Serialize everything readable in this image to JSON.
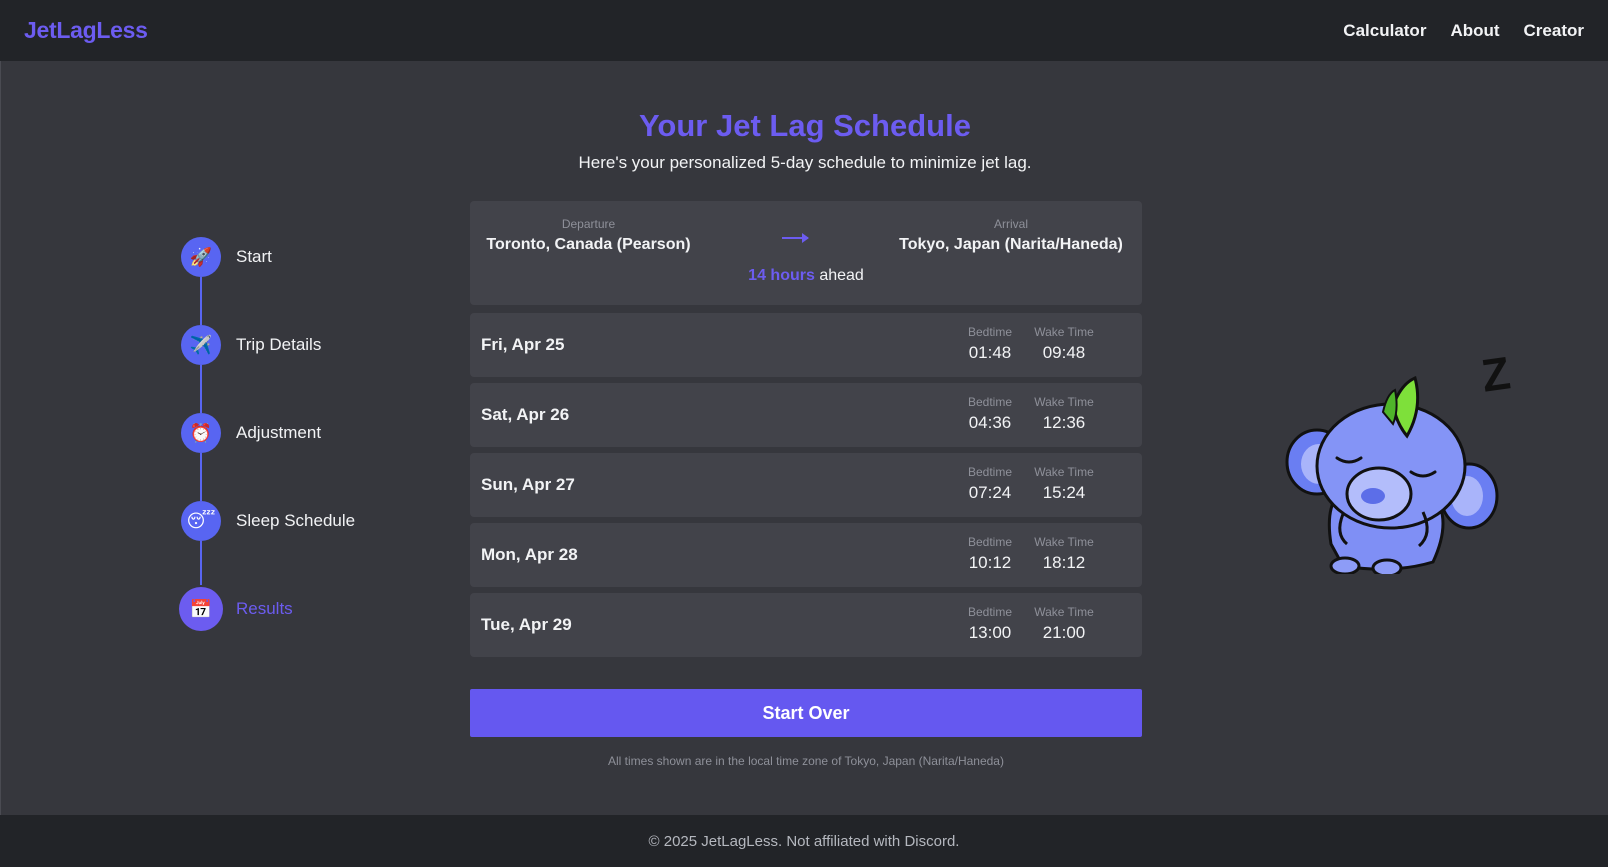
{
  "header": {
    "logo": "JetLagLess",
    "nav": [
      {
        "label": "Calculator"
      },
      {
        "label": "About"
      },
      {
        "label": "Creator"
      }
    ]
  },
  "page": {
    "title": "Your Jet Lag Schedule",
    "subtitle": "Here's your personalized 5-day schedule to minimize jet lag."
  },
  "stepper": {
    "steps": [
      {
        "label": "Start",
        "icon": "rocket-icon",
        "glyph": "🚀",
        "active": false
      },
      {
        "label": "Trip Details",
        "icon": "airplane-icon",
        "glyph": "✈️",
        "active": false
      },
      {
        "label": "Adjustment",
        "icon": "alarm-clock-icon",
        "glyph": "⏰",
        "active": false
      },
      {
        "label": "Sleep Schedule",
        "icon": "sleeping-face-icon",
        "glyph": "😴",
        "active": false
      },
      {
        "label": "Results",
        "icon": "calendar-icon",
        "glyph": "📅",
        "active": true
      }
    ]
  },
  "route": {
    "departure_caption": "Departure",
    "departure": "Toronto, Canada (Pearson)",
    "arrival_caption": "Arrival",
    "arrival": "Tokyo, Japan (Narita/Haneda)",
    "offset_value": "14 hours",
    "offset_suffix": "ahead",
    "arrow_icon": "arrow-right-icon"
  },
  "schedule": {
    "bedtime_caption": "Bedtime",
    "wake_caption": "Wake Time",
    "days": [
      {
        "date": "Fri, Apr 25",
        "bedtime": "01:48",
        "wake": "09:48"
      },
      {
        "date": "Sat, Apr 26",
        "bedtime": "04:36",
        "wake": "12:36"
      },
      {
        "date": "Sun, Apr 27",
        "bedtime": "07:24",
        "wake": "15:24"
      },
      {
        "date": "Mon, Apr 28",
        "bedtime": "10:12",
        "wake": "18:12"
      },
      {
        "date": "Tue, Apr 29",
        "bedtime": "13:00",
        "wake": "21:00"
      }
    ]
  },
  "actions": {
    "start_over_label": "Start Over"
  },
  "note": "All times shown are in the local time zone of Tokyo, Japan (Narita/Haneda)",
  "mascot": {
    "icon": "sleeping-koala-mascot-icon",
    "zzz": "Z"
  },
  "footer": {
    "text": "© 2025 JetLagLess. Not affiliated with Discord."
  },
  "colors": {
    "accent": "#6c5cf0",
    "step_circle": "#5865f2",
    "header_bg": "#222428",
    "main_bg": "#36373d",
    "card_bg": "#42434a",
    "button_bg": "#6558f0"
  }
}
